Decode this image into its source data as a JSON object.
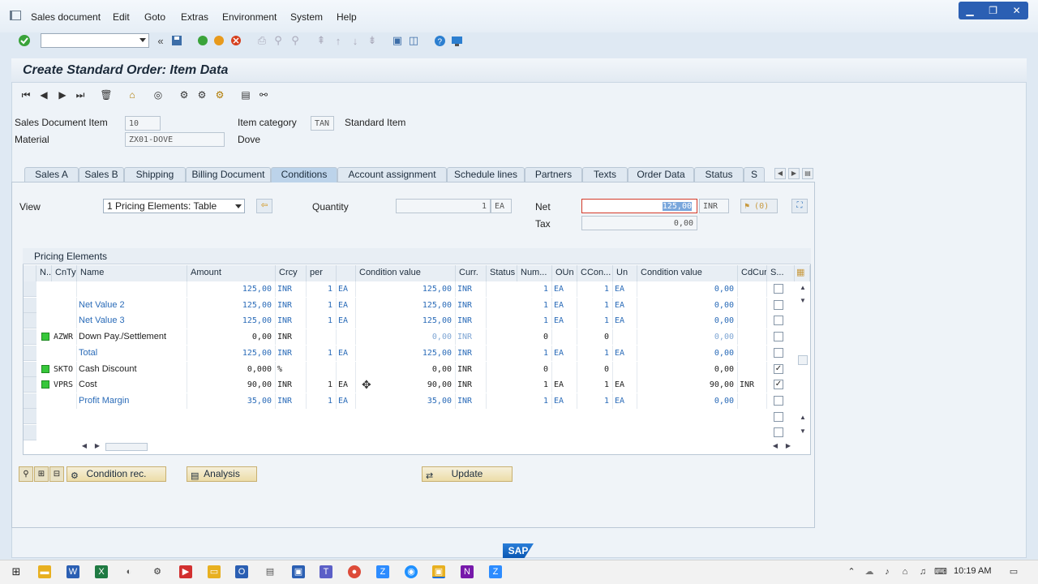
{
  "menubar": {
    "items": [
      "Sales document",
      "Edit",
      "Goto",
      "Extras",
      "Environment",
      "System",
      "Help"
    ]
  },
  "window": {
    "title": "Create Standard Order: Item Data"
  },
  "header": {
    "sales_document_item_label": "Sales Document Item",
    "sales_document_item_value": "10",
    "item_category_label": "Item category",
    "item_category_value": "TAN",
    "item_category_text": "Standard Item",
    "material_label": "Material",
    "material_value": "ZX01-DOVE",
    "material_text": "Dove"
  },
  "tabs": [
    "Sales A",
    "Sales B",
    "Shipping",
    "Billing Document",
    "Conditions",
    "Account assignment",
    "Schedule lines",
    "Partners",
    "Texts",
    "Order Data",
    "Status",
    "S"
  ],
  "active_tab": "Conditions",
  "conditions": {
    "view_label": "View",
    "view_value": "1 Pricing Elements: Table",
    "quantity_label": "Quantity",
    "quantity_value": "1",
    "quantity_unit": "EA",
    "net_label": "Net",
    "net_value": "125,00",
    "net_currency": "INR",
    "tax_label": "Tax",
    "tax_value": "0,00",
    "badge": "(0)"
  },
  "pricing": {
    "title": "Pricing Elements",
    "columns": [
      "N..",
      "CnTy",
      "Name",
      "Amount",
      "Crcy",
      "per",
      "",
      "Condition value",
      "Curr.",
      "Status",
      "Num...",
      "OUn",
      "CCon...",
      "Un",
      "Condition value",
      "CdCur",
      "S..."
    ],
    "rows": [
      {
        "cnty": "",
        "name": "",
        "amount": "125,00",
        "crcy": "INR",
        "per": "1",
        "uom": "EA",
        "cond_value": "125,00",
        "curr": "INR",
        "num": "1",
        "oun": "EA",
        "ccon": "1",
        "un": "EA",
        "cond_value2": "0,00",
        "cdcur": "",
        "checked": false
      },
      {
        "cnty": "",
        "name": "Net Value 2",
        "amount": "125,00",
        "crcy": "INR",
        "per": "1",
        "uom": "EA",
        "cond_value": "125,00",
        "curr": "INR",
        "num": "1",
        "oun": "EA",
        "ccon": "1",
        "un": "EA",
        "cond_value2": "0,00",
        "cdcur": "",
        "checked": false
      },
      {
        "cnty": "",
        "name": "Net Value 3",
        "amount": "125,00",
        "crcy": "INR",
        "per": "1",
        "uom": "EA",
        "cond_value": "125,00",
        "curr": "INR",
        "num": "1",
        "oun": "EA",
        "ccon": "1",
        "un": "EA",
        "cond_value2": "0,00",
        "cdcur": "",
        "checked": false
      },
      {
        "cnty": "AZWR",
        "name": "Down Pay./Settlement",
        "amount": "0,00",
        "crcy": "INR",
        "per": "",
        "uom": "",
        "cond_value": "0,00",
        "curr": "INR",
        "num": "0",
        "oun": "",
        "ccon": "0",
        "un": "",
        "cond_value2": "0,00",
        "cdcur": "",
        "checked": false
      },
      {
        "cnty": "",
        "name": "Total",
        "amount": "125,00",
        "crcy": "INR",
        "per": "1",
        "uom": "EA",
        "cond_value": "125,00",
        "curr": "INR",
        "num": "1",
        "oun": "EA",
        "ccon": "1",
        "un": "EA",
        "cond_value2": "0,00",
        "cdcur": "",
        "checked": false
      },
      {
        "cnty": "SKTO",
        "name": "Cash Discount",
        "amount": "0,000",
        "crcy": "%",
        "per": "",
        "uom": "",
        "cond_value": "0,00",
        "curr": "INR",
        "num": "0",
        "oun": "",
        "ccon": "0",
        "un": "",
        "cond_value2": "0,00",
        "cdcur": "",
        "checked": true
      },
      {
        "cnty": "VPRS",
        "name": "Cost",
        "amount": "90,00",
        "crcy": "INR",
        "per": "1",
        "uom": "EA",
        "cond_value": "90,00",
        "curr": "INR",
        "num": "1",
        "oun": "EA",
        "ccon": "1",
        "un": "EA",
        "cond_value2": "90,00",
        "cdcur": "INR",
        "checked": true
      },
      {
        "cnty": "",
        "name": "Profit Margin",
        "amount": "35,00",
        "crcy": "INR",
        "per": "1",
        "uom": "EA",
        "cond_value": "35,00",
        "curr": "INR",
        "num": "1",
        "oun": "EA",
        "ccon": "1",
        "un": "EA",
        "cond_value2": "0,00",
        "cdcur": "",
        "checked": false
      }
    ]
  },
  "buttons": {
    "condition_rec": "Condition rec.",
    "analysis": "Analysis",
    "update": "Update"
  },
  "branding": {
    "logo_text": "SAP"
  },
  "taskbar": {
    "time": "10:19 AM"
  }
}
